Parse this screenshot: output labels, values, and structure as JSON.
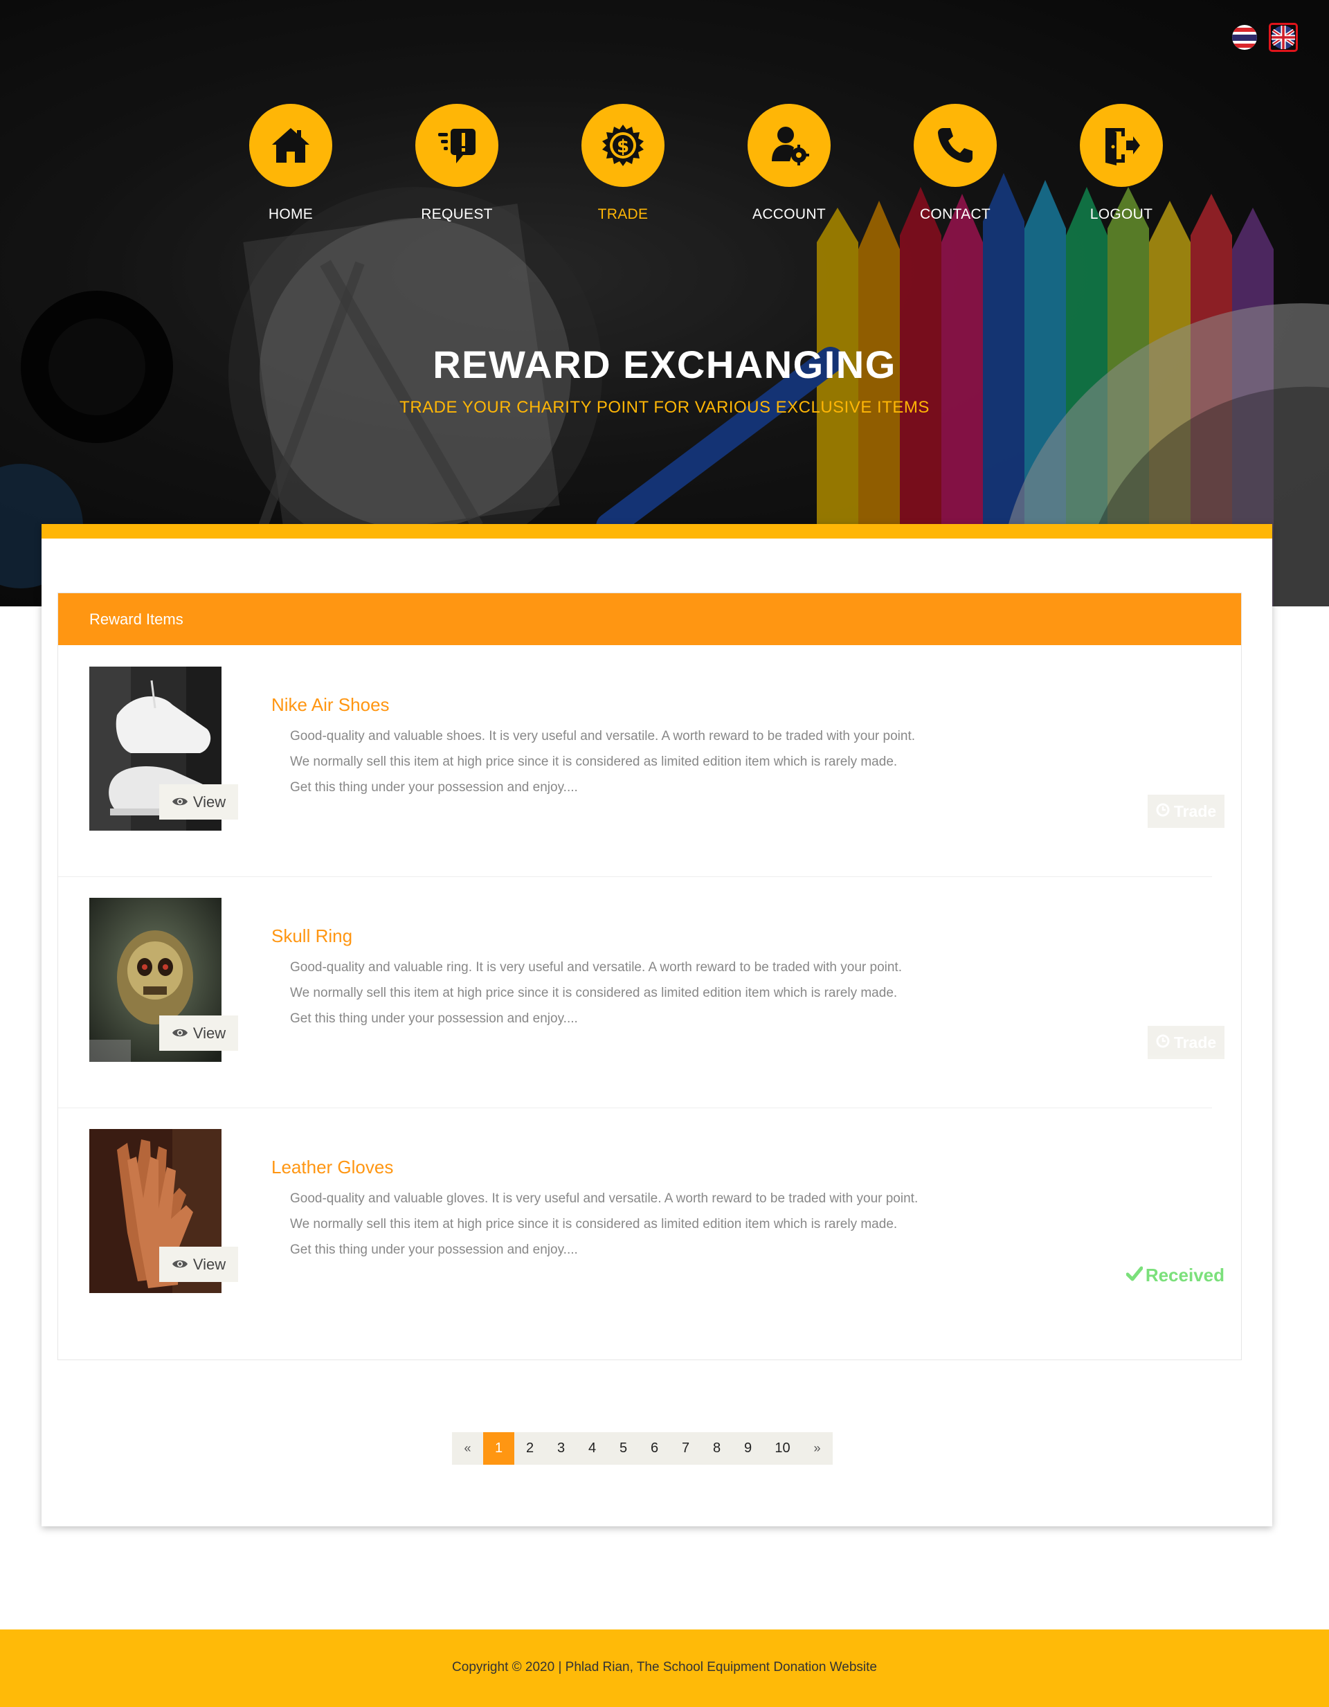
{
  "header": {
    "languages": [
      {
        "code": "th",
        "icon": "thai-flag-icon"
      },
      {
        "code": "en",
        "icon": "uk-flag-icon",
        "selected": true
      }
    ],
    "nav": [
      {
        "label": "HOME",
        "icon": "home-icon"
      },
      {
        "label": "REQUEST",
        "icon": "request-icon"
      },
      {
        "label": "TRADE",
        "icon": "trade-coin-icon",
        "active": true
      },
      {
        "label": "ACCOUNT",
        "icon": "account-settings-icon"
      },
      {
        "label": "CONTACT",
        "icon": "phone-icon"
      },
      {
        "label": "LOGOUT",
        "icon": "logout-door-icon"
      }
    ]
  },
  "hero": {
    "title": "REWARD EXCHANGING",
    "subtitle": "TRADE YOUR CHARITY POINT FOR VARIOUS EXCLUSIVE ITEMS"
  },
  "rewards": {
    "heading": "Reward Items",
    "view_label": "View",
    "trade_label": "Trade",
    "received_label": "Received",
    "items": [
      {
        "title": "Nike Air Shoes",
        "desc": [
          "Good-quality and valuable shoes. It is very useful and versatile. A worth reward to be traded with your point.",
          "We normally sell this item at high price since it is considered as limited edition item which is rarely made.",
          "Get this thing under your possession and enjoy...."
        ],
        "status": "trade"
      },
      {
        "title": "Skull Ring",
        "desc": [
          "Good-quality and valuable ring. It is very useful and versatile. A worth reward to be traded with your point.",
          "We normally sell this item at high price since it is considered as limited edition item which is rarely made.",
          "Get this thing under your possession and enjoy...."
        ],
        "status": "trade"
      },
      {
        "title": "Leather Gloves",
        "desc": [
          "Good-quality and valuable gloves. It is very useful and versatile. A worth reward to be traded with your point.",
          "We normally sell this item at high price since it is considered as limited edition item which is rarely made.",
          "Get this thing under your possession and enjoy...."
        ],
        "status": "received"
      }
    ]
  },
  "pagination": {
    "prev": "«",
    "next": "»",
    "pages": [
      "1",
      "2",
      "3",
      "4",
      "5",
      "6",
      "7",
      "8",
      "9",
      "10"
    ],
    "current": "1"
  },
  "footer": {
    "copyright": "Copyright © 2020 | Phlad Rian, The School Equipment Donation Website"
  },
  "colors": {
    "accent": "#ffb606",
    "panel_header": "#ff9612",
    "received": "#7be07b"
  }
}
